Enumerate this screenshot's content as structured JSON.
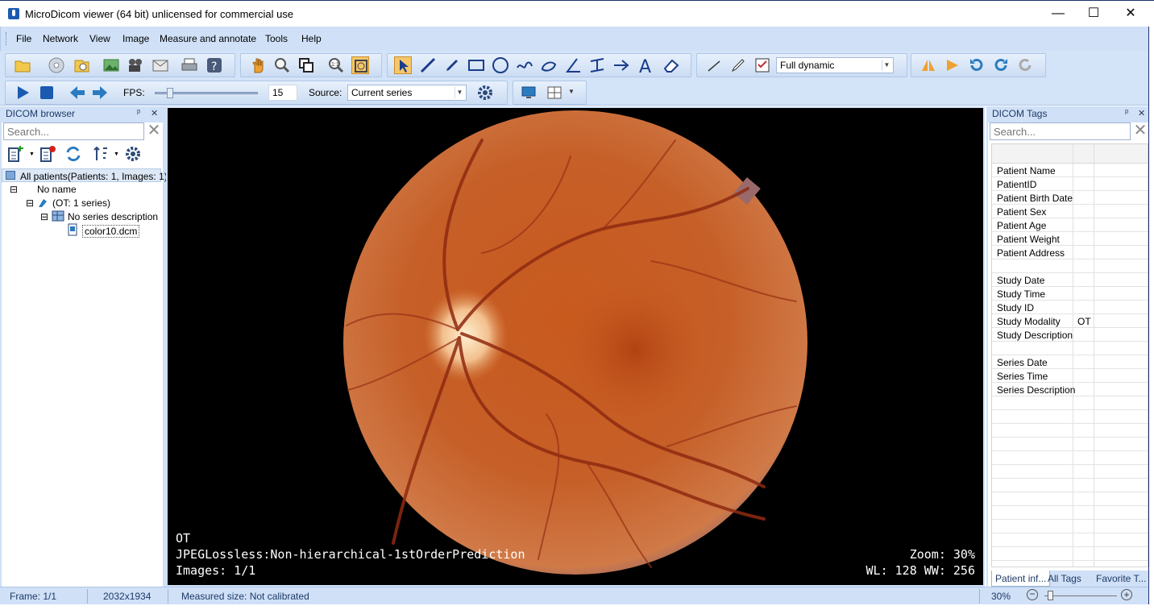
{
  "window": {
    "title": "MicroDicom viewer (64 bit) unlicensed for commercial use",
    "controls": {
      "minimize": "—",
      "maximize": "☐",
      "close": "✕"
    }
  },
  "menu": [
    "File",
    "Network",
    "View",
    "Image",
    "Measure and annotate",
    "Tools",
    "Help"
  ],
  "toolbar": {
    "wl_preset": "Full dynamic",
    "fps_label": "FPS:",
    "fps_value": "15",
    "source_label": "Source:",
    "source_value": "Current series"
  },
  "browser": {
    "title": "DICOM browser",
    "search_placeholder": "Search...",
    "tree": {
      "root": "All patients(Patients: 1, Images: 1)",
      "patient": "No name",
      "study": "(OT: 1 series)",
      "series": "No series description",
      "file": "color10.dcm"
    }
  },
  "viewer": {
    "overlay_modality": "OT",
    "overlay_transfer": "JPEGLossless:Non-hierarchical-1stOrderPrediction",
    "overlay_images": "Images: 1/1",
    "overlay_zoom": "Zoom: 30%",
    "overlay_wlww": "WL: 128 WW: 256"
  },
  "tags": {
    "title": "DICOM Tags",
    "search_placeholder": "Search...",
    "rows": [
      {
        "k": "Patient Name",
        "v": ""
      },
      {
        "k": "PatientID",
        "v": ""
      },
      {
        "k": "Patient Birth Date",
        "v": ""
      },
      {
        "k": "Patient Sex",
        "v": ""
      },
      {
        "k": "Patient Age",
        "v": ""
      },
      {
        "k": "Patient Weight",
        "v": ""
      },
      {
        "k": "Patient Address",
        "v": ""
      },
      {
        "k": "",
        "v": ""
      },
      {
        "k": "Study Date",
        "v": ""
      },
      {
        "k": "Study Time",
        "v": ""
      },
      {
        "k": "Study ID",
        "v": ""
      },
      {
        "k": "Study Modality",
        "v": "OT"
      },
      {
        "k": "Study Description",
        "v": ""
      },
      {
        "k": "",
        "v": ""
      },
      {
        "k": "Series Date",
        "v": ""
      },
      {
        "k": "Series Time",
        "v": ""
      },
      {
        "k": "Series Description",
        "v": ""
      }
    ],
    "tabs": [
      "Patient inf...",
      "All Tags",
      "Favorite T..."
    ]
  },
  "status": {
    "frame": "Frame: 1/1",
    "size": "2032x1934",
    "measured": "Measured size: Not calibrated",
    "zoom": "30%"
  },
  "colors": {
    "accent": "#cfe0f7",
    "viewer_bg": "#000000"
  }
}
